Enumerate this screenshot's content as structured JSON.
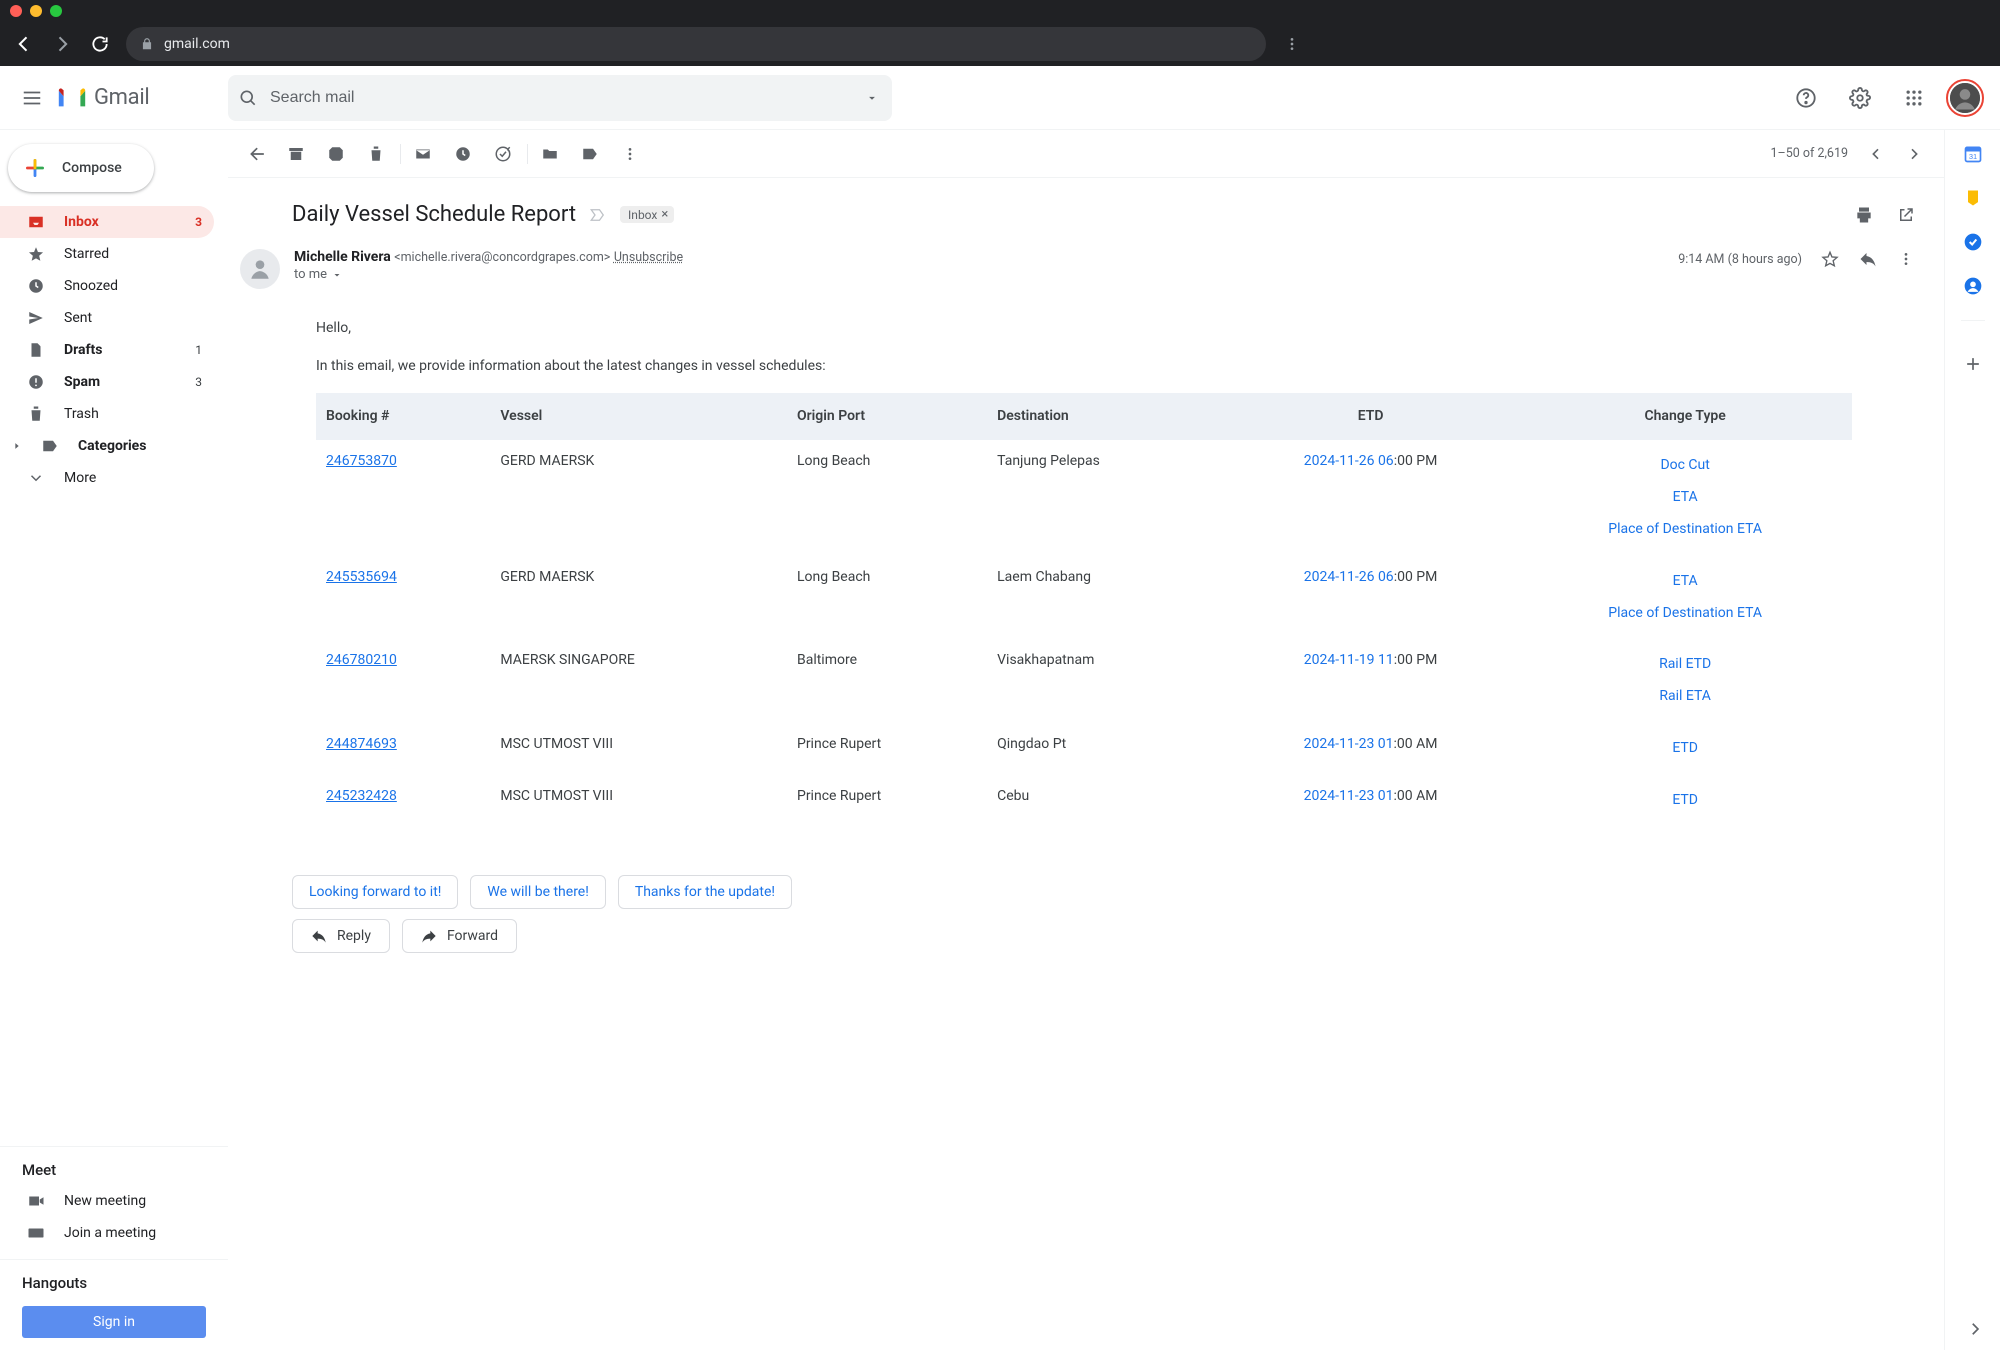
{
  "browser": {
    "url": "gmail.com"
  },
  "app": {
    "name": "Gmail",
    "search_placeholder": "Search mail"
  },
  "compose_label": "Compose",
  "nav": [
    {
      "label": "Inbox",
      "count": "3",
      "selected": true,
      "icon": "inbox"
    },
    {
      "label": "Starred",
      "count": "",
      "selected": false,
      "icon": "star"
    },
    {
      "label": "Snoozed",
      "count": "",
      "selected": false,
      "icon": "clock"
    },
    {
      "label": "Sent",
      "count": "",
      "selected": false,
      "icon": "send"
    },
    {
      "label": "Drafts",
      "count": "1",
      "selected": false,
      "icon": "file",
      "bold": true
    },
    {
      "label": "Spam",
      "count": "3",
      "selected": false,
      "icon": "spam",
      "bold": true
    },
    {
      "label": "Trash",
      "count": "",
      "selected": false,
      "icon": "trash"
    },
    {
      "label": "Categories",
      "count": "",
      "selected": false,
      "icon": "label",
      "bold": true
    },
    {
      "label": "More",
      "count": "",
      "selected": false,
      "icon": "chevron"
    }
  ],
  "meet": {
    "header": "Meet",
    "new_meeting": "New meeting",
    "join_meeting": "Join a meeting"
  },
  "hangouts": {
    "header": "Hangouts",
    "sign_in": "Sign in"
  },
  "toolbar": {
    "page_info": "1–50 of 2,619"
  },
  "message": {
    "subject": "Daily Vessel Schedule Report",
    "chip_label": "Inbox",
    "sender_name": "Michelle Rivera",
    "sender_email": "<michelle.rivera@concordgrapes.com>",
    "unsubscribe": "Unsubscribe",
    "recipient": "to me",
    "timestamp": "9:14 AM",
    "timestamp_rel": "(8 hours ago)",
    "greeting": "Hello,",
    "intro": "In this email, we provide information about the latest changes in vessel schedules:",
    "headers": {
      "booking": "Booking #",
      "vessel": "Vessel",
      "origin": "Origin Port",
      "destination": "Destination",
      "etd": "ETD",
      "change": "Change Type"
    },
    "rows": [
      {
        "booking": "246753870",
        "vessel": "GERD MAERSK",
        "origin": "Long Beach",
        "dest": "Tanjung Pelepas",
        "etd_link": "2024-11-26 06",
        "etd_tail": ":00 PM",
        "changes": [
          "Doc Cut",
          "ETA",
          "Place of Destination ETA"
        ]
      },
      {
        "booking": "245535694",
        "vessel": "GERD MAERSK",
        "origin": "Long Beach",
        "dest": "Laem Chabang",
        "etd_link": "2024-11-26 06",
        "etd_tail": ":00 PM",
        "changes": [
          "ETA",
          "Place of Destination ETA"
        ]
      },
      {
        "booking": "246780210",
        "vessel": "MAERSK SINGAPORE",
        "origin": "Baltimore",
        "dest": "Visakhapatnam",
        "etd_link": "2024-11-19 11",
        "etd_tail": ":00 PM",
        "changes": [
          "Rail ETD",
          "Rail ETA"
        ]
      },
      {
        "booking": "244874693",
        "vessel": "MSC UTMOST VIII",
        "origin": "Prince Rupert",
        "dest": "Qingdao Pt",
        "etd_link": "2024-11-23 01",
        "etd_tail": ":00 AM",
        "changes": [
          "ETD"
        ]
      },
      {
        "booking": "245232428",
        "vessel": "MSC UTMOST VIII",
        "origin": "Prince Rupert",
        "dest": "Cebu",
        "etd_link": "2024-11-23 01",
        "etd_tail": ":00 AM",
        "changes": [
          "ETD"
        ]
      }
    ]
  },
  "smart_replies": [
    "Looking forward to it!",
    "We will be there!",
    "Thanks for the update!"
  ],
  "actions": {
    "reply": "Reply",
    "forward": "Forward"
  }
}
